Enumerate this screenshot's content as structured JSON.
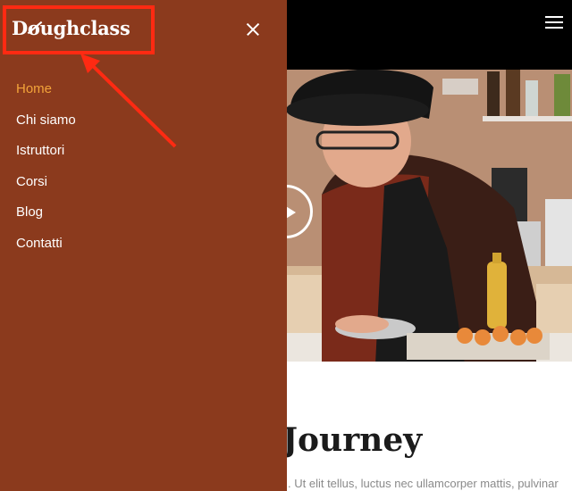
{
  "drawer": {
    "logo": "Doughclass",
    "logo_parts": {
      "before": "D",
      "mark": "o",
      "after": "ughclass"
    },
    "nav_items": [
      {
        "label": "Home",
        "active": true
      },
      {
        "label": "Chi siamo",
        "active": false
      },
      {
        "label": "Istruttori",
        "active": false
      },
      {
        "label": "Corsi",
        "active": false
      },
      {
        "label": "Blog",
        "active": false
      },
      {
        "label": "Contatti",
        "active": false
      }
    ],
    "close_icon": "close-icon"
  },
  "page": {
    "menu_icon": "hamburger-icon",
    "play_icon": "play-icon",
    "hero_alt": "chef-photo",
    "heading": "Journey",
    "body_text": ". Ut elit tellus, luctus nec ullamcorper mattis, pulvinar"
  },
  "colors": {
    "drawer_bg": "#8b3a1d",
    "active_nav": "#f2a33a",
    "topbar_bg": "#000000",
    "annotation": "#ff2a12"
  }
}
